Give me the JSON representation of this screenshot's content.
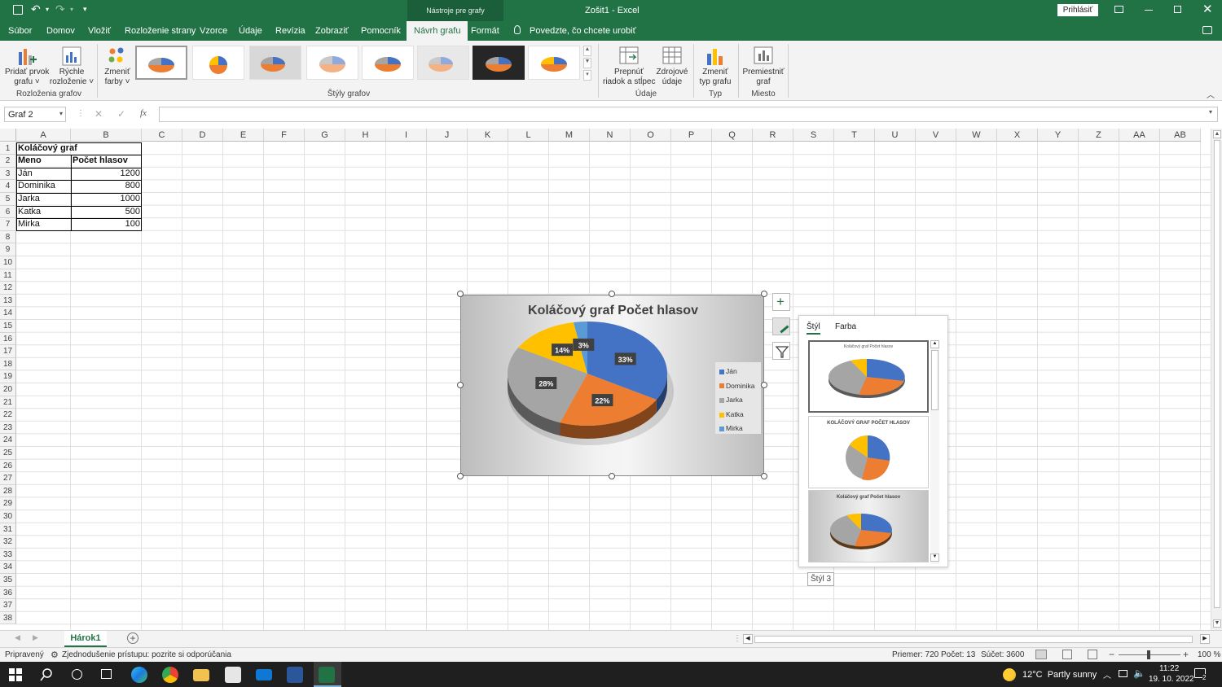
{
  "titlebar": {
    "context_tab": "Nástroje pre grafy",
    "title": "Zošit1 - Excel",
    "signin": "Prihlásiť"
  },
  "menu": {
    "items": [
      "Súbor",
      "Domov",
      "Vložiť",
      "Rozloženie strany",
      "Vzorce",
      "Údaje",
      "Revízia",
      "Zobraziť",
      "Pomocník",
      "Návrh grafu",
      "Formát"
    ],
    "active": "Návrh grafu",
    "tellme": "Povedzte, čo chcete urobiť"
  },
  "ribbon": {
    "add_element": [
      "Pridať prvok",
      "grafu ˅"
    ],
    "quick_layout": [
      "Rýchle",
      "rozloženie ˅"
    ],
    "change_colors": [
      "Zmeniť",
      "farby ˅"
    ],
    "switch_row_col": [
      "Prepnúť",
      "riadok a stĺpec"
    ],
    "select_data": [
      "Zdrojové",
      "údaje"
    ],
    "change_type": [
      "Zmeniť",
      "typ grafu"
    ],
    "move_chart": [
      "Premiestniť",
      "graf"
    ],
    "groups": {
      "layouts": "Rozloženia grafov",
      "styles": "Štýly grafov",
      "data": "Údaje",
      "type": "Typ",
      "location": "Miesto"
    }
  },
  "formula": {
    "namebox": "Graf 2",
    "fx": "fx",
    "value": ""
  },
  "grid": {
    "columns": [
      "A",
      "B",
      "C",
      "D",
      "E",
      "F",
      "G",
      "H",
      "I",
      "J",
      "K",
      "L",
      "M",
      "N",
      "O",
      "P",
      "Q",
      "R",
      "S",
      "T",
      "U",
      "V",
      "W",
      "X",
      "Y",
      "Z",
      "AA",
      "AB"
    ],
    "rows": [
      "1",
      "2",
      "3",
      "4",
      "5",
      "6",
      "7",
      "8",
      "9",
      "10",
      "11",
      "12",
      "13",
      "14",
      "15",
      "16",
      "17",
      "18",
      "19",
      "20",
      "21",
      "22",
      "23",
      "24",
      "25",
      "26",
      "27",
      "28",
      "29",
      "30",
      "31",
      "32",
      "33",
      "34",
      "35",
      "36",
      "37",
      "38"
    ],
    "cells": {
      "a1": "Koláčový graf",
      "a2": "Meno",
      "b2": "Počet hlasov",
      "data": [
        {
          "name": "Ján",
          "value": "1200"
        },
        {
          "name": "Dominika",
          "value": "800"
        },
        {
          "name": "Jarka",
          "value": "1000"
        },
        {
          "name": "Katka",
          "value": "500"
        },
        {
          "name": "Mirka",
          "value": "100"
        }
      ]
    }
  },
  "chart_data": {
    "type": "pie",
    "title": "Koláčový graf  Počet hlasov",
    "categories": [
      "Ján",
      "Dominika",
      "Jarka",
      "Katka",
      "Mirka"
    ],
    "values": [
      1200,
      800,
      1000,
      500,
      100
    ],
    "percent_labels": [
      "33%",
      "22%",
      "28%",
      "14%",
      "3%"
    ],
    "colors": [
      "#4472c4",
      "#ed7d31",
      "#a5a5a5",
      "#ffc000",
      "#5b9bd5"
    ],
    "legend": "right"
  },
  "style_panel": {
    "tabs": [
      "Štýl",
      "Farba"
    ],
    "active_tab": "Štýl",
    "thumb2_title": "KOLÁČOVÝ GRAF  POČET HLASOV",
    "thumb3_title": "Koláčový graf  Počet hlasov",
    "tooltip": "Štýl 3"
  },
  "sheet": {
    "tab": "Hárok1"
  },
  "status": {
    "ready": "Pripravený",
    "accessibility": "Zjednodušenie prístupu: pozrite si odporúčania",
    "average": "Priemer: 720",
    "count": "Počet: 13",
    "sum": "Súčet: 3600",
    "zoom": "100 %"
  },
  "taskbar": {
    "weather": "12°C  Partly sunny",
    "time": "11:22",
    "date": "19. 10. 2022",
    "notifications": "2"
  },
  "colors": {
    "excel_green": "#217346"
  }
}
